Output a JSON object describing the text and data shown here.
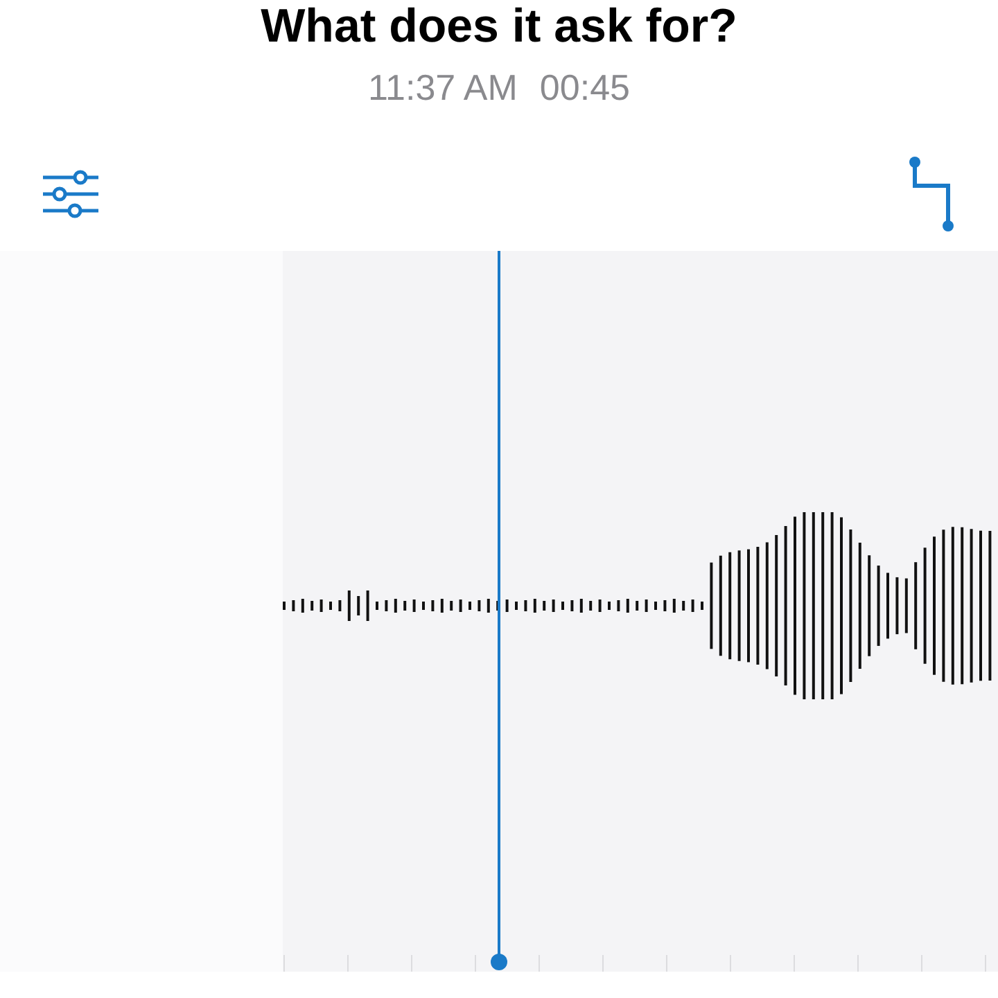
{
  "recording": {
    "title": "What does it ask for?",
    "recorded_time": "11:37 AM",
    "duration": "00:45"
  }
}
